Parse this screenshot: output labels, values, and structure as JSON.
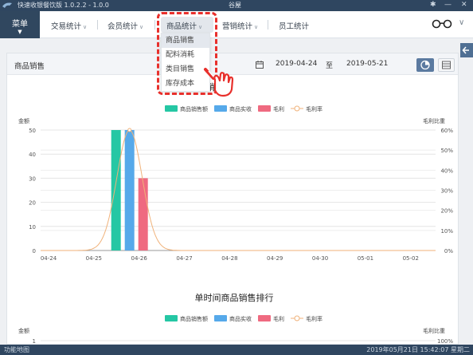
{
  "titlebar": {
    "app": "快速收银餐饮版 1.0.2.2 - 1.0.0",
    "store": "谷屋"
  },
  "menu": {
    "label": "菜单"
  },
  "nav": [
    {
      "label": "交易统计"
    },
    {
      "label": "会员统计"
    },
    {
      "label": "商品统计"
    },
    {
      "label": "营销统计"
    },
    {
      "label": "员工统计"
    }
  ],
  "dropdown": [
    {
      "label": "商品销售",
      "selected": true
    },
    {
      "label": "配料消耗",
      "selected": false
    },
    {
      "label": "类目销售",
      "selected": false
    },
    {
      "label": "库存成本",
      "selected": false
    }
  ],
  "card": {
    "title": "商品销售",
    "date_from": "2019-04-24",
    "date_sep": "至",
    "date_to": "2019-05-21"
  },
  "colors": {
    "sales": "#25c7a4",
    "received": "#56a9ea",
    "profit": "#ef6a80",
    "rate": "#f0b27a"
  },
  "chart_data": [
    {
      "type": "bar",
      "title": "销售",
      "series": [
        {
          "name": "商品销售额",
          "values": [
            0,
            0,
            50,
            0,
            0,
            0,
            0,
            0,
            0
          ]
        },
        {
          "name": "商品实收",
          "values": [
            0,
            0,
            50,
            0,
            0,
            0,
            0,
            0,
            0
          ]
        },
        {
          "name": "毛利",
          "values": [
            0,
            0,
            30,
            0,
            0,
            0,
            0,
            0,
            0
          ]
        },
        {
          "name": "毛利率",
          "type": "line",
          "axis": "right",
          "values": [
            0,
            0,
            60,
            0,
            0,
            0,
            0,
            0,
            0
          ]
        }
      ],
      "categories": [
        "04-24",
        "04-25",
        "04-26",
        "04-27",
        "04-28",
        "04-29",
        "04-30",
        "05-01",
        "05-02"
      ],
      "ylabel": "金额",
      "y2label": "毛利比重",
      "ylim": [
        0,
        50
      ],
      "y2lim": [
        0,
        60
      ],
      "yticks": [
        "0",
        "10",
        "20",
        "30",
        "40",
        "50"
      ],
      "y2ticks": [
        "0%",
        "10%",
        "20%",
        "30%",
        "40%",
        "50%",
        "60%"
      ],
      "legend": "top-center",
      "grid": true
    },
    {
      "type": "bar",
      "title": "单时间商品销售排行",
      "series": [
        {
          "name": "商品销售额",
          "values": []
        },
        {
          "name": "商品实收",
          "values": []
        },
        {
          "name": "毛利",
          "values": []
        },
        {
          "name": "毛利率",
          "values": []
        }
      ],
      "ylabel": "金额",
      "y2label": "毛利比重",
      "yticks": [
        "1"
      ],
      "y2ticks": [
        "100%"
      ],
      "legend": "top-center"
    }
  ],
  "statusbar": {
    "left": "功能地图",
    "right": "2019年05月21日 15:42:07 星期二"
  }
}
